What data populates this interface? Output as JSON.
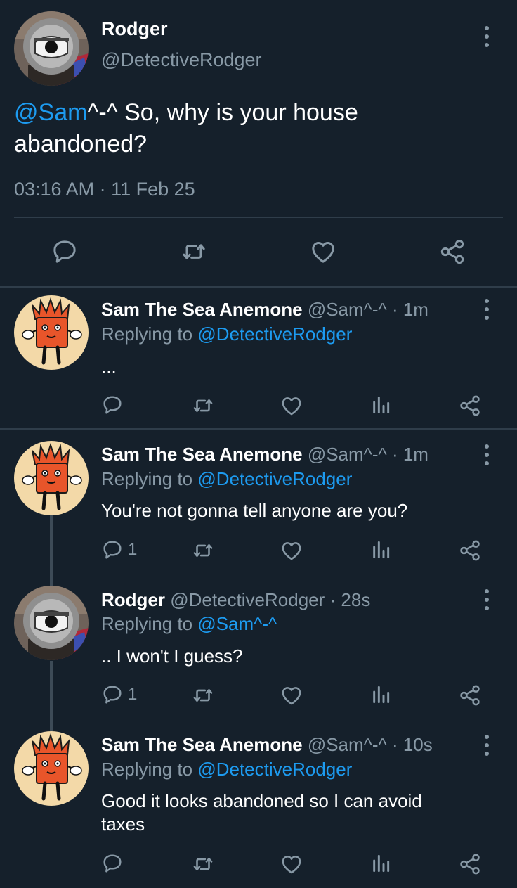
{
  "main_tweet": {
    "name": "Rodger",
    "handle": "@DetectiveRodger",
    "mention": "@Sam",
    "text_line1": "^-^ So, why is your house",
    "text_line2": "abandoned?",
    "timestamp": "03:16 AM · 11 Feb 25"
  },
  "replies": [
    {
      "name": "Sam The Sea Anemone",
      "handle": "@Sam^-^",
      "time": "· 1m",
      "replying_prefix": "Replying to ",
      "replying_to": "@DetectiveRodger",
      "text": "...",
      "reply_count": ""
    },
    {
      "name": "Sam The Sea Anemone",
      "handle": "@Sam^-^",
      "time": "· 1m",
      "replying_prefix": "Replying to ",
      "replying_to": "@DetectiveRodger",
      "text": "You're not gonna tell anyone are you?",
      "reply_count": "1"
    },
    {
      "name": "Rodger",
      "handle": "@DetectiveRodger",
      "time": "· 28s",
      "replying_prefix": "Replying to ",
      "replying_to": "@Sam^-^",
      "text": ".. I won't I guess?",
      "reply_count": "1"
    },
    {
      "name": "Sam The Sea Anemone",
      "handle": "@Sam^-^",
      "time": "· 10s",
      "replying_prefix": "Replying to ",
      "replying_to": "@DetectiveRodger",
      "text_line1": "Good it looks abandoned so I can avoid",
      "text_line2": "taxes",
      "reply_count": ""
    }
  ],
  "colors": {
    "background": "#15202b",
    "text": "#ffffff",
    "muted": "#8899a6",
    "link": "#1d9bf0"
  }
}
